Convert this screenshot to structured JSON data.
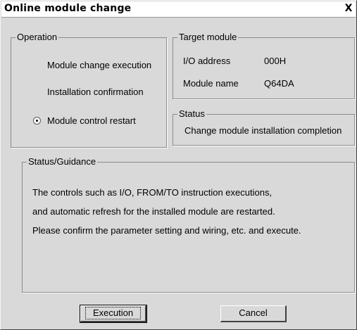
{
  "window": {
    "title": "Online module change",
    "close_glyph": "X"
  },
  "operation": {
    "legend": "Operation",
    "items": [
      {
        "label": "Module change execution",
        "selected": false
      },
      {
        "label": "Installation confirmation",
        "selected": false
      },
      {
        "label": "Module control restart",
        "selected": true
      }
    ]
  },
  "target_module": {
    "legend": "Target module",
    "io_address_label": "I/O address",
    "io_address_value": "000H",
    "module_name_label": "Module name",
    "module_name_value": "Q64DA"
  },
  "status": {
    "legend": "Status",
    "text": "Change module installation completion"
  },
  "guidance": {
    "legend": "Status/Guidance",
    "lines": [
      "The controls such as I/O, FROM/TO instruction executions,",
      "and automatic refresh for the installed module are restarted.",
      "Please confirm the parameter setting and wiring, etc. and execute."
    ]
  },
  "buttons": {
    "execution": "Execution",
    "cancel": "Cancel"
  }
}
